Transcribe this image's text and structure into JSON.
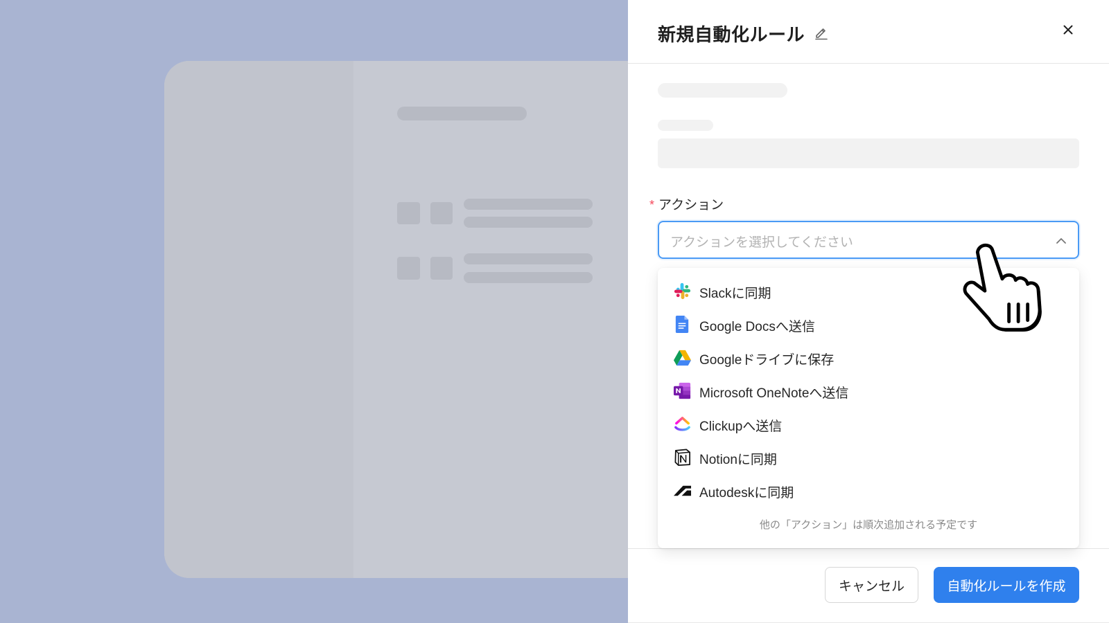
{
  "theme": {
    "overlay": "#a9b4d2",
    "accent": "#2f80ed",
    "required": "#f5485b"
  },
  "drawer": {
    "title": "新規自動化ルール",
    "title_edit_icon": "pencil-icon",
    "close_icon": "close-icon"
  },
  "form": {
    "required_mark": "*",
    "action_label": "アクション",
    "action_placeholder": "アクションを選択してください",
    "select_icon": "chevron-up-icon"
  },
  "dropdown": {
    "options": [
      {
        "label": "Slackに同期",
        "icon": "slack-icon"
      },
      {
        "label": "Google Docsへ送信",
        "icon": "google-docs-icon"
      },
      {
        "label": "Googleドライブに保存",
        "icon": "google-drive-icon"
      },
      {
        "label": "Microsoft OneNoteへ送信",
        "icon": "onenote-icon"
      },
      {
        "label": "Clickupへ送信",
        "icon": "clickup-icon"
      },
      {
        "label": "Notionに同期",
        "icon": "notion-icon"
      },
      {
        "label": "Autodeskに同期",
        "icon": "autodesk-icon"
      }
    ],
    "note": "他の「アクション」は順次追加される予定です"
  },
  "footer": {
    "cancel_label": "キャンセル",
    "submit_label": "自動化ルールを作成"
  },
  "cursor": {
    "icon": "pointing-hand-cursor-icon"
  }
}
